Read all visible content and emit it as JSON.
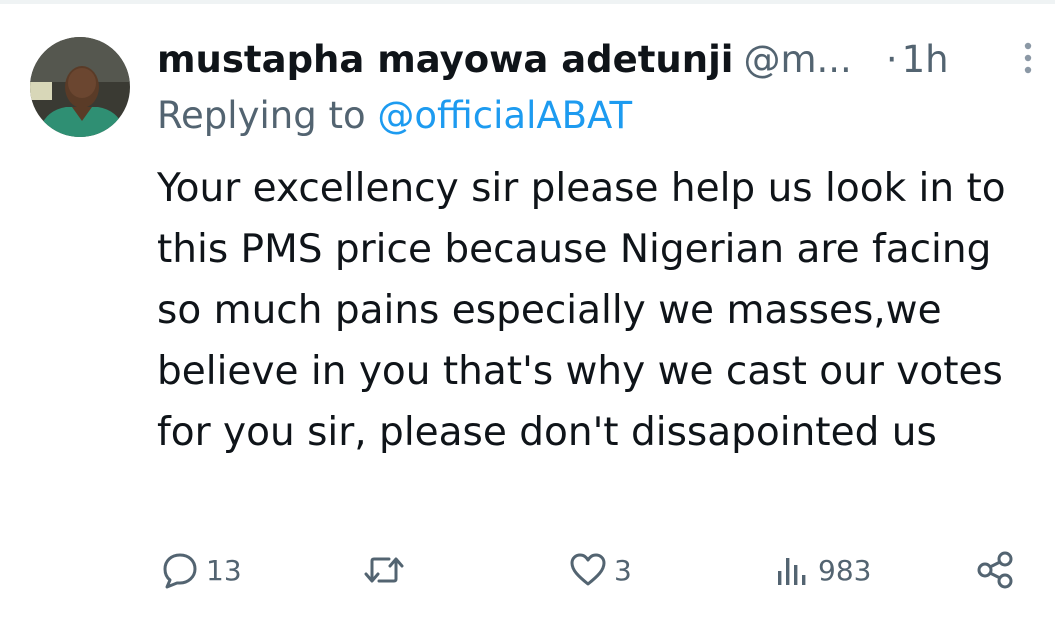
{
  "tweet": {
    "display_name": "mustapha mayowa adetunji",
    "handle": "@m...",
    "time_separator": "·",
    "time": "1h",
    "replying_prefix": "Replying to",
    "replying_to": "@officialABAT",
    "text": "Your excellency sir please help us look in to this PMS price because Nigerian are facing so much pains especially we masses,we believe in you that's why we cast our votes for you sir, please don't dissapointed us"
  },
  "actions": {
    "replies": "13",
    "retweets": "",
    "likes": "3",
    "views": "983"
  },
  "colors": {
    "text_primary": "#0f1419",
    "text_secondary": "#536471",
    "link": "#1d9bf0",
    "divider": "#eff3f4"
  },
  "icons": {
    "more": "more-vertical-icon",
    "reply": "reply-bubble-icon",
    "retweet": "retweet-icon",
    "like": "heart-icon",
    "views": "views-bar-chart-icon",
    "share": "share-icon"
  }
}
